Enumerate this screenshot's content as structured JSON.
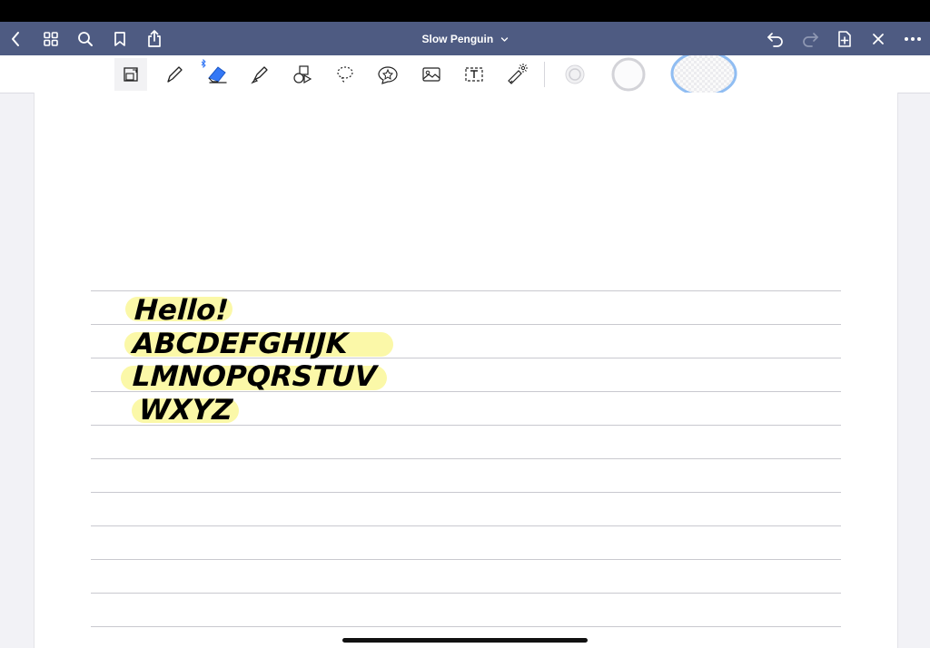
{
  "app": {
    "document_title": "Slow Penguin"
  },
  "navbar": {
    "icons": [
      "chevron-left-icon",
      "grid-icon",
      "search-icon",
      "bookmark-icon",
      "share-icon",
      "chevron-down-icon",
      "undo-icon",
      "redo-icon",
      "add-page-icon",
      "close-icon",
      "more-icon"
    ]
  },
  "toolbar": {
    "tools": [
      "zoom-window-icon",
      "pen-icon",
      "eraser-icon",
      "highlighter-icon",
      "shapes-icon",
      "lasso-icon",
      "sticker-icon",
      "image-icon",
      "text-icon",
      "laser-pointer-icon"
    ],
    "selected_tool": "eraser-icon",
    "bluetooth_indicator_color": "#3478f6",
    "eraser_color": "#3478f6"
  },
  "colors": {
    "navbar": "#4e5b82",
    "highlight": "#fbf8a8",
    "selected_size_ring": "#90bdf2"
  },
  "notebook": {
    "handwriting_lines": [
      "Hello!",
      "ABCDEFGHIJK",
      "LMNOPQRSTUV",
      "WXYZ"
    ]
  }
}
